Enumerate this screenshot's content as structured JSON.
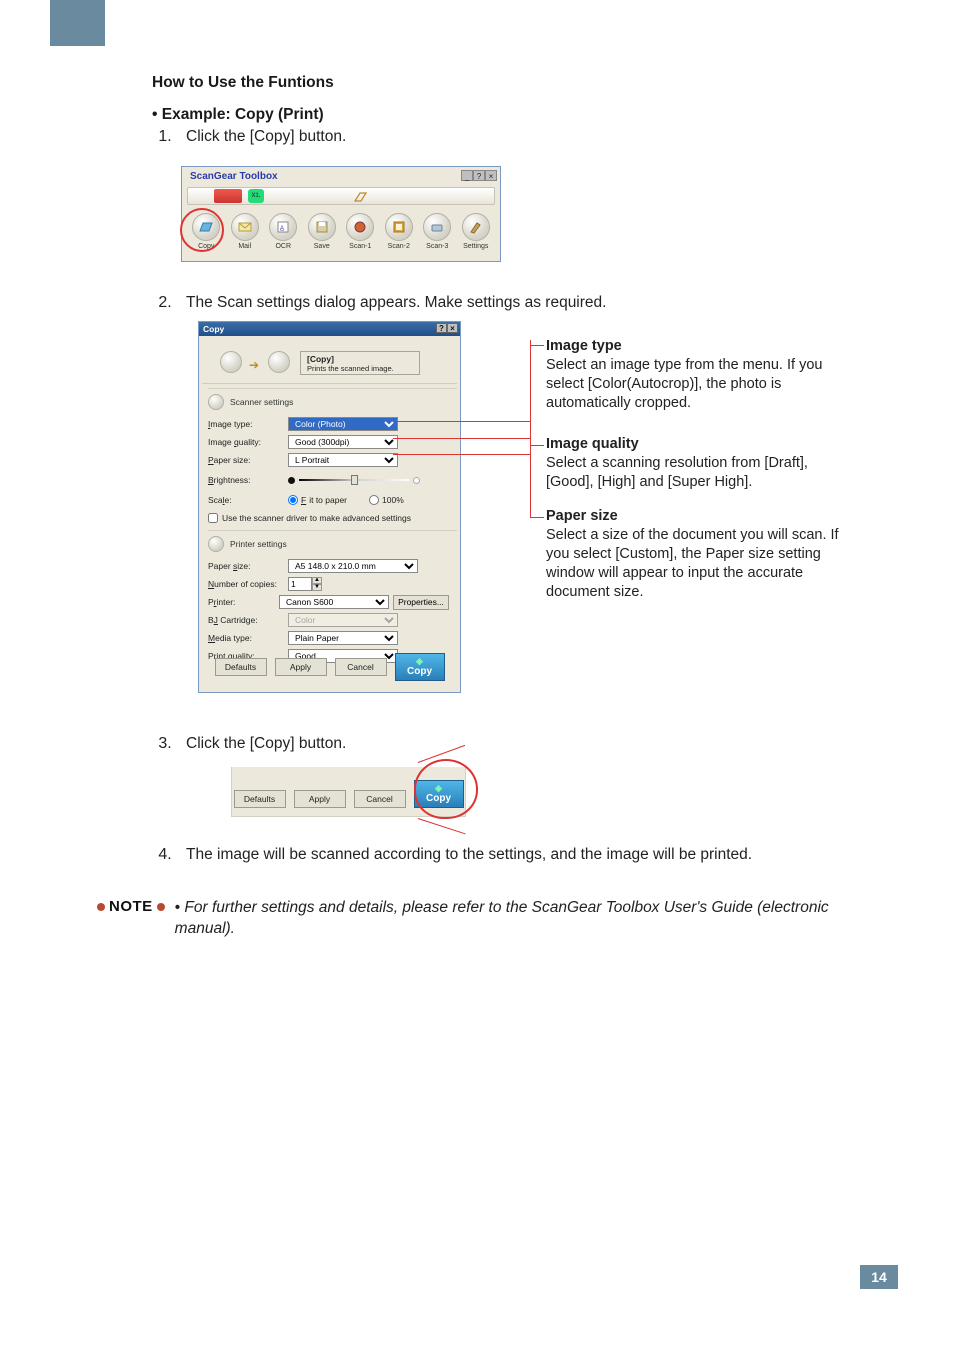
{
  "headings": {
    "section": "How to Use the Funtions",
    "example": "• Example: Copy (Print)"
  },
  "steps": {
    "s1": {
      "num": "1.",
      "text": "Click the [Copy] button."
    },
    "s2": {
      "num": "2.",
      "text": "The Scan settings dialog appears. Make settings as required."
    },
    "s3": {
      "num": "3.",
      "text": "Click the [Copy] button."
    },
    "s4": {
      "num": "4.",
      "text": "The image will be scanned according to the settings, and the image will be printed."
    }
  },
  "toolbox": {
    "title": "ScanGear Toolbox",
    "strip_text": "X1.",
    "buttons": {
      "copy": "Copy",
      "mail": "Mail",
      "ocr": "OCR",
      "save": "Save",
      "scan1": "Scan-1",
      "scan2": "Scan-2",
      "scan3": "Scan-3",
      "settings": "Settings"
    },
    "win": {
      "min": "_",
      "help": "?",
      "close": "×"
    }
  },
  "dialog": {
    "title": "Copy",
    "win": {
      "help": "?",
      "close": "×"
    },
    "header": {
      "title": "[Copy]",
      "subtitle": "Prints the scanned image."
    },
    "group_scanner": "Scanner settings",
    "group_printer": "Printer settings",
    "labels": {
      "image_type": "Image type:",
      "image_quality": "Image quality:",
      "paper_size_scan": "Paper size:",
      "brightness": "Brightness:",
      "scale": "Scale:",
      "fit": "Fit to paper",
      "hundred": "100%",
      "advanced": "Use the scanner driver to make advanced settings",
      "paper_size_print": "Paper size:",
      "copies": "Number of copies:",
      "printer": "Printer:",
      "properties": "Properties...",
      "cartridge": "BJ Cartridge:",
      "media": "Media type:",
      "print_quality": "Print quality:"
    },
    "values": {
      "image_type": "Color (Photo)",
      "image_quality": "Good (300dpi)",
      "paper_size_scan": "L Portrait",
      "paper_size_print": "A5 148.0 x 210.0 mm",
      "copies": "1",
      "printer": "Canon S600",
      "cartridge": "Color",
      "media": "Plain Paper",
      "print_quality": "Good"
    },
    "buttons": {
      "defaults": "Defaults",
      "apply": "Apply",
      "cancel": "Cancel",
      "copy": "Copy"
    }
  },
  "annotations": {
    "image_type": {
      "title": "Image type",
      "body": "Select an image type from the menu. If you select [Color(Autocrop)], the photo is automatically cropped."
    },
    "image_quality": {
      "title": "Image quality",
      "body": "Select a scanning resolution from [Draft], [Good], [High] and [Super High]."
    },
    "paper_size": {
      "title": "Paper size",
      "body": "Select a size of the document you will scan. If you select [Custom], the Paper size setting window will appear to input the accurate document size."
    }
  },
  "note": {
    "label": "NOTE",
    "text": "• For further settings and details, please refer to the ScanGear Toolbox User's Guide (electronic manual)."
  },
  "page_number": "14"
}
